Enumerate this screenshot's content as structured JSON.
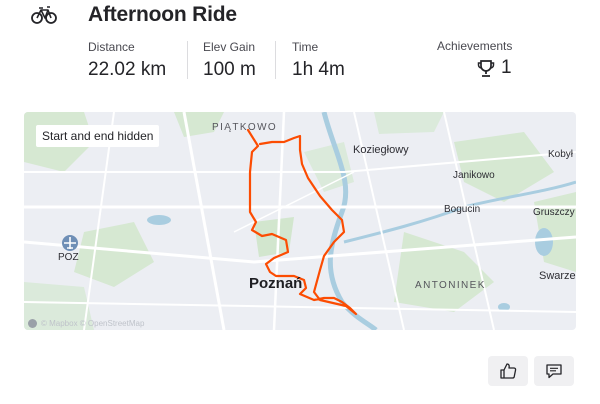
{
  "activity": {
    "type_icon": "bike-icon",
    "title": "Afternoon Ride"
  },
  "stats": [
    {
      "label": "Distance",
      "value": "22.02 km"
    },
    {
      "label": "Elev Gain",
      "value": "100 m"
    },
    {
      "label": "Time",
      "value": "1h 4m"
    }
  ],
  "achievements": {
    "label": "Achievements",
    "icon": "trophy-icon",
    "count": "1"
  },
  "map": {
    "badge": "Start and end hidden",
    "labels": {
      "piatkowo": "PIĄTKOWO",
      "koziegLowy": "Koziegłowy",
      "kobyl": "Kobył",
      "janikowo": "Janikowo",
      "bogucin": "Bogucin",
      "gruszczyn": "Gruszczy",
      "poz": "POZ",
      "poznan": "Poznań",
      "swarzedz": "Swarze",
      "antoninek": "ANTONINEK"
    },
    "attribution": "© Mapbox © OpenStreetMap",
    "route_color": "#fc4c02"
  },
  "actions": {
    "kudos_icon": "thumbs-up-icon",
    "comment_icon": "comment-icon"
  }
}
